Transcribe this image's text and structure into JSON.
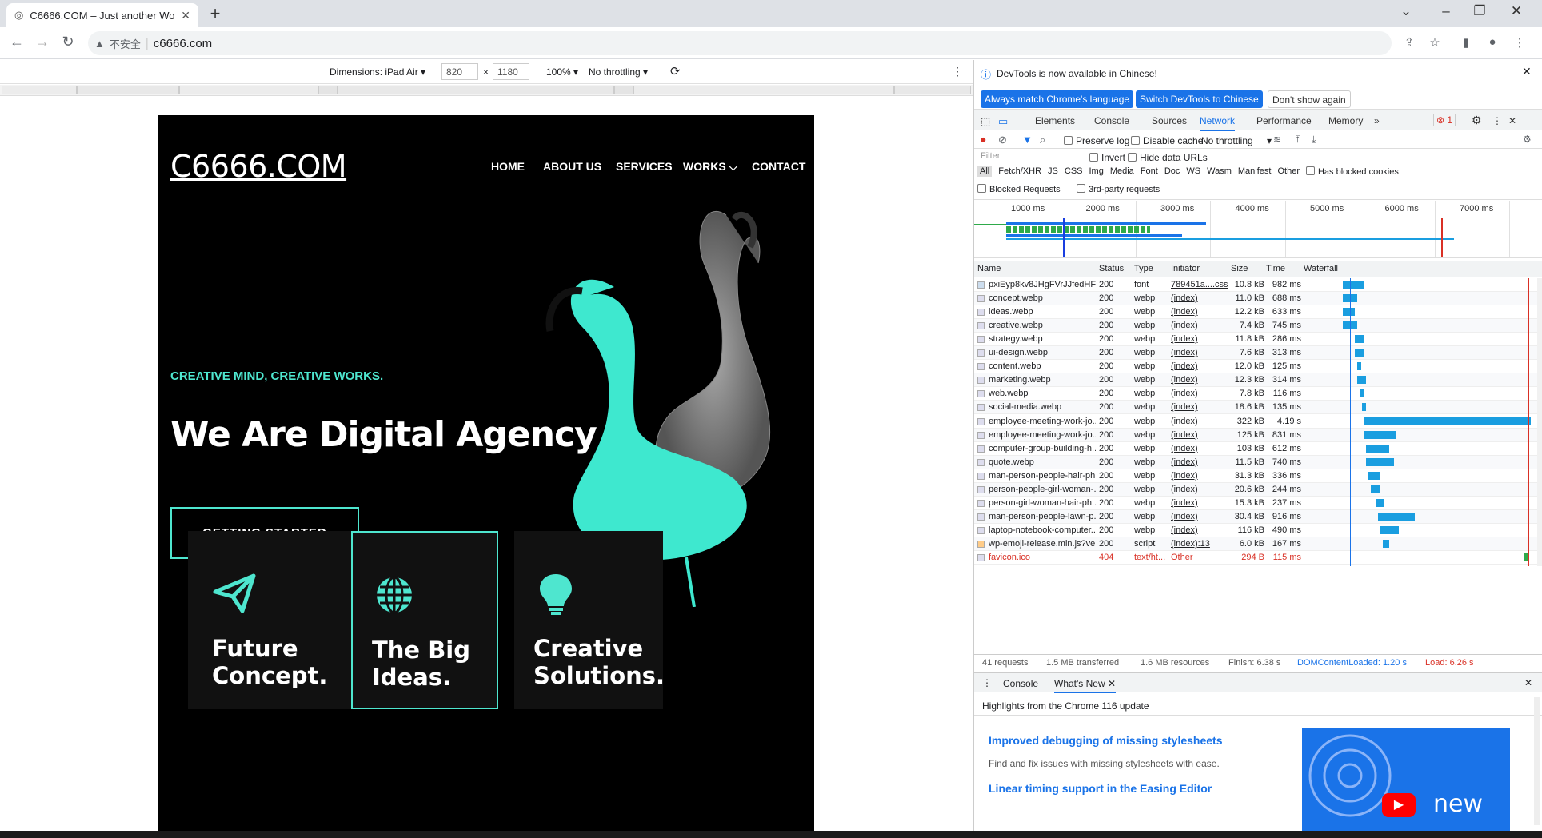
{
  "browser": {
    "tab_title": "C6666.COM – Just another Wo",
    "new_tab": "+",
    "security_label": "不安全",
    "url": "c6666.com"
  },
  "device_toolbar": {
    "dimensions_label": "Dimensions: iPad Air ▾",
    "width": "820",
    "times": "×",
    "height": "1180",
    "zoom": "100% ▾",
    "throttle": "No throttling ▾"
  },
  "site": {
    "logo": "C6666.COM",
    "menu": [
      "HOME",
      "ABOUT US",
      "SERVICES",
      "WORKS ⌵",
      "CONTACT"
    ],
    "tagline": "CREATIVE MIND, CREATIVE WORKS.",
    "heading": "We Are Digital Agency",
    "cta": "GETTING STARTED",
    "cards": [
      {
        "title_l1": "Future",
        "title_l2": "Concept.",
        "icon": "paper-plane-icon"
      },
      {
        "title_l1": "The Big",
        "title_l2": "Ideas.",
        "icon": "globe-icon"
      },
      {
        "title_l1": "Creative",
        "title_l2": "Solutions.",
        "icon": "lightbulb-icon"
      }
    ],
    "accent_color": "#4ee6cf"
  },
  "devtools": {
    "info_text": "DevTools is now available in Chinese!",
    "btn_match": "Always match Chrome's language",
    "btn_switch": "Switch DevTools to Chinese",
    "btn_dont": "Don't show again",
    "tabs": [
      "Elements",
      "Console",
      "Sources",
      "Network",
      "Performance",
      "Memory",
      "»"
    ],
    "error_count": "1",
    "preserve_log": "Preserve log",
    "disable_cache": "Disable cache",
    "throttling": "No throttling",
    "filter_placeholder": "Filter",
    "invert": "Invert",
    "hide_data_urls": "Hide data URLs",
    "types": [
      "All",
      "Fetch/XHR",
      "JS",
      "CSS",
      "Img",
      "Media",
      "Font",
      "Doc",
      "WS",
      "Wasm",
      "Manifest",
      "Other"
    ],
    "has_blocked_cookies": "Has blocked cookies",
    "blocked_requests": "Blocked Requests",
    "third_party": "3rd-party requests",
    "timeline_ticks": [
      "1000 ms",
      "2000 ms",
      "3000 ms",
      "4000 ms",
      "5000 ms",
      "6000 ms",
      "7000 ms"
    ],
    "columns": [
      "Name",
      "Status",
      "Type",
      "Initiator",
      "Size",
      "Time",
      "Waterfall"
    ],
    "rows": [
      {
        "name": "pxiEyp8kv8JHgFVrJJfedHFH...",
        "status": "200",
        "type": "font",
        "initiator": "789451a....css",
        "size": "10.8 kB",
        "time": "982 ms",
        "wf_start": 0.17,
        "wf_len": 0.09
      },
      {
        "name": "concept.webp",
        "status": "200",
        "type": "webp",
        "initiator": "(index)",
        "size": "11.0 kB",
        "time": "688 ms",
        "wf_start": 0.17,
        "wf_len": 0.06
      },
      {
        "name": "ideas.webp",
        "status": "200",
        "type": "webp",
        "initiator": "(index)",
        "size": "12.2 kB",
        "time": "633 ms",
        "wf_start": 0.17,
        "wf_len": 0.05
      },
      {
        "name": "creative.webp",
        "status": "200",
        "type": "webp",
        "initiator": "(index)",
        "size": "7.4 kB",
        "time": "745 ms",
        "wf_start": 0.17,
        "wf_len": 0.06
      },
      {
        "name": "strategy.webp",
        "status": "200",
        "type": "webp",
        "initiator": "(index)",
        "size": "11.8 kB",
        "time": "286 ms",
        "wf_start": 0.22,
        "wf_len": 0.04
      },
      {
        "name": "ui-design.webp",
        "status": "200",
        "type": "webp",
        "initiator": "(index)",
        "size": "7.6 kB",
        "time": "313 ms",
        "wf_start": 0.22,
        "wf_len": 0.04
      },
      {
        "name": "content.webp",
        "status": "200",
        "type": "webp",
        "initiator": "(index)",
        "size": "12.0 kB",
        "time": "125 ms",
        "wf_start": 0.23,
        "wf_len": 0.02
      },
      {
        "name": "marketing.webp",
        "status": "200",
        "type": "webp",
        "initiator": "(index)",
        "size": "12.3 kB",
        "time": "314 ms",
        "wf_start": 0.23,
        "wf_len": 0.04
      },
      {
        "name": "web.webp",
        "status": "200",
        "type": "webp",
        "initiator": "(index)",
        "size": "7.8 kB",
        "time": "116 ms",
        "wf_start": 0.24,
        "wf_len": 0.02
      },
      {
        "name": "social-media.webp",
        "status": "200",
        "type": "webp",
        "initiator": "(index)",
        "size": "18.6 kB",
        "time": "135 ms",
        "wf_start": 0.25,
        "wf_len": 0.02
      },
      {
        "name": "employee-meeting-work-jo...",
        "status": "200",
        "type": "webp",
        "initiator": "(index)",
        "size": "322 kB",
        "time": "4.19 s",
        "wf_start": 0.26,
        "wf_len": 0.72
      },
      {
        "name": "employee-meeting-work-jo...",
        "status": "200",
        "type": "webp",
        "initiator": "(index)",
        "size": "125 kB",
        "time": "831 ms",
        "wf_start": 0.26,
        "wf_len": 0.14
      },
      {
        "name": "computer-group-building-h...",
        "status": "200",
        "type": "webp",
        "initiator": "(index)",
        "size": "103 kB",
        "time": "612 ms",
        "wf_start": 0.27,
        "wf_len": 0.1
      },
      {
        "name": "quote.webp",
        "status": "200",
        "type": "webp",
        "initiator": "(index)",
        "size": "11.5 kB",
        "time": "740 ms",
        "wf_start": 0.27,
        "wf_len": 0.12
      },
      {
        "name": "man-person-people-hair-ph...",
        "status": "200",
        "type": "webp",
        "initiator": "(index)",
        "size": "31.3 kB",
        "time": "336 ms",
        "wf_start": 0.28,
        "wf_len": 0.05
      },
      {
        "name": "person-people-girl-woman-...",
        "status": "200",
        "type": "webp",
        "initiator": "(index)",
        "size": "20.6 kB",
        "time": "244 ms",
        "wf_start": 0.29,
        "wf_len": 0.04
      },
      {
        "name": "person-girl-woman-hair-ph...",
        "status": "200",
        "type": "webp",
        "initiator": "(index)",
        "size": "15.3 kB",
        "time": "237 ms",
        "wf_start": 0.31,
        "wf_len": 0.04
      },
      {
        "name": "man-person-people-lawn-p...",
        "status": "200",
        "type": "webp",
        "initiator": "(index)",
        "size": "30.4 kB",
        "time": "916 ms",
        "wf_start": 0.32,
        "wf_len": 0.16
      },
      {
        "name": "laptop-notebook-computer...",
        "status": "200",
        "type": "webp",
        "initiator": "(index)",
        "size": "116 kB",
        "time": "490 ms",
        "wf_start": 0.33,
        "wf_len": 0.08
      },
      {
        "name": "wp-emoji-release.min.js?ver...",
        "status": "200",
        "type": "script",
        "initiator": "(index):13",
        "size": "6.0 kB",
        "time": "167 ms",
        "wf_start": 0.34,
        "wf_len": 0.03
      },
      {
        "name": "favicon.ico",
        "status": "404",
        "type": "text/ht...",
        "initiator": "Other",
        "size": "294 B",
        "time": "115 ms",
        "wf_start": 0.95,
        "wf_len": 0.02
      }
    ],
    "summary": {
      "requests": "41 requests",
      "transferred": "1.5 MB transferred",
      "resources": "1.6 MB resources",
      "finish": "Finish: 6.38 s",
      "dcl": "DOMContentLoaded: 1.20 s",
      "load": "Load: 6.26 s"
    },
    "drawer": {
      "tabs": [
        "Console",
        "What's New"
      ],
      "highlight": "Highlights from the Chrome 116 update",
      "item1_title": "Improved debugging of missing stylesheets",
      "item1_desc": "Find and fix issues with missing stylesheets with ease.",
      "item2_title": "Linear timing support in the Easing Editor",
      "video_label": "new"
    }
  }
}
